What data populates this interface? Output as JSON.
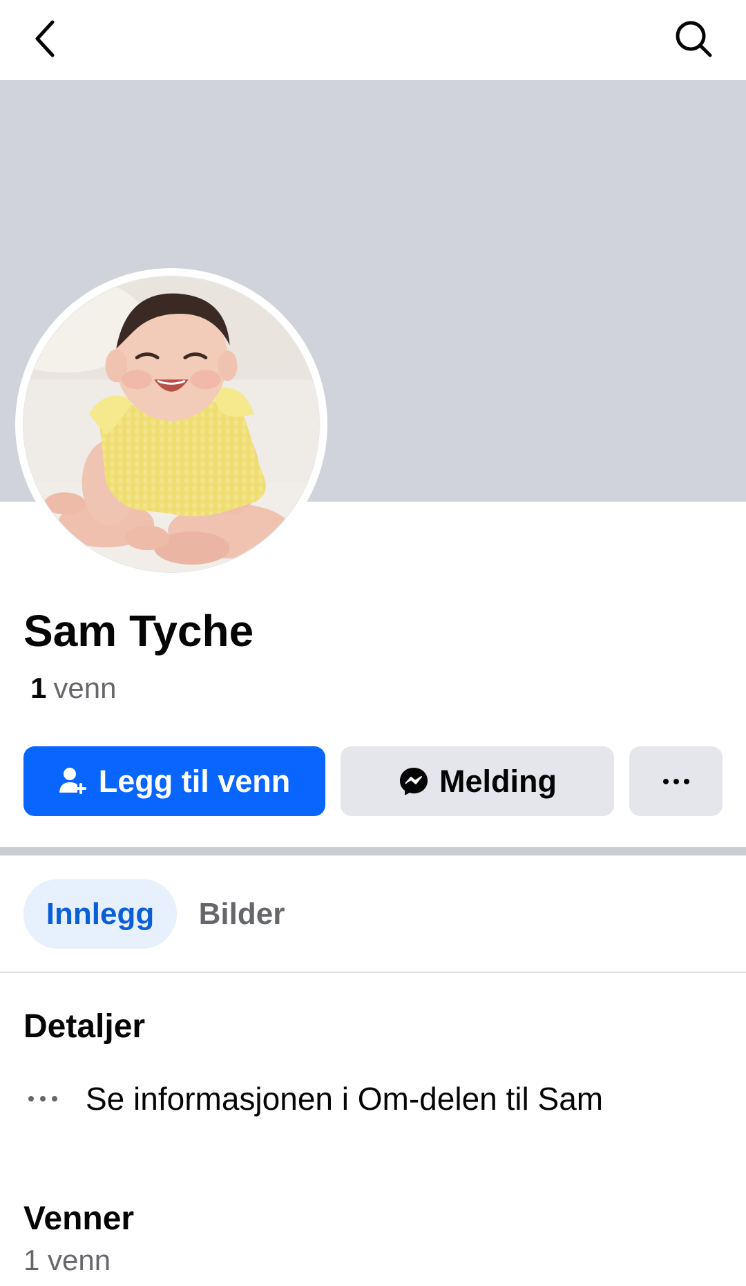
{
  "topbar": {
    "back_icon": "chevron-left-icon",
    "search_icon": "search-icon"
  },
  "profile": {
    "name": "Sam Tyche",
    "friend_count": "1",
    "friend_word": "venn",
    "avatar_description_icon": "profile-photo"
  },
  "actions": {
    "add_friend_label": "Legg til venn",
    "add_friend_icon": "add-friend-icon",
    "message_label": "Melding",
    "message_icon": "messenger-icon",
    "more_icon": "more-horizontal-icon"
  },
  "tabs": [
    {
      "label": "Innlegg",
      "active": true
    },
    {
      "label": "Bilder",
      "active": false
    }
  ],
  "details": {
    "title": "Detaljer",
    "about_link": "Se informasjonen i Om-delen til Sam",
    "about_icon": "more-horizontal-icon"
  },
  "friends": {
    "title": "Venner",
    "subtitle": "1 venn"
  },
  "colors": {
    "primary": "#0866ff",
    "secondary_button": "#e4e6eb",
    "cover": "#d0d3d9",
    "active_tab_bg": "#e7f1fe",
    "muted_text": "#65676b"
  }
}
